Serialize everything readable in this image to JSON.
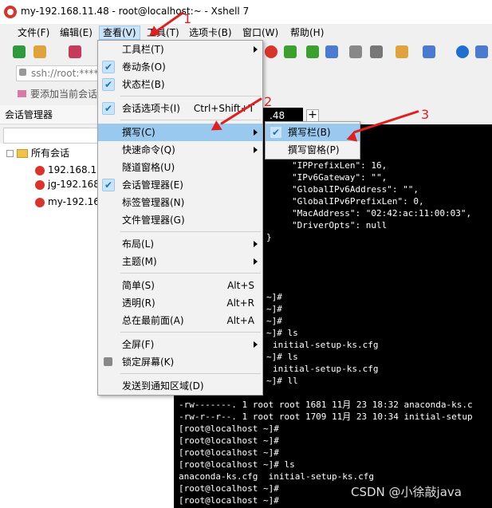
{
  "window": {
    "title": "my-192.168.11.48 - root@localhost:~ - Xshell 7"
  },
  "menubar": {
    "items": [
      "文件(F)",
      "编辑(E)",
      "查看(V)",
      "工具(T)",
      "选项卡(B)",
      "窗口(W)",
      "帮助(H)"
    ]
  },
  "addressbar": {
    "value": "ssh://root:*****"
  },
  "linkbar": {
    "text": "要添加当前会话"
  },
  "session_panel": {
    "title": "会话管理器",
    "tree": [
      {
        "label": "所有会话"
      },
      {
        "label": "192.168.16"
      },
      {
        "label": "jg-192.168"
      },
      {
        "label": "my-192.16"
      }
    ]
  },
  "tab": {
    "active_label": ".48",
    "add_label": "+"
  },
  "view_menu": {
    "items": [
      {
        "label": "工具栏(T)",
        "accel": "",
        "check": false,
        "sub": true
      },
      {
        "label": "卷动条(O)",
        "accel": "",
        "check": true,
        "sub": false
      },
      {
        "label": "状态栏(B)",
        "accel": "",
        "check": true,
        "sub": false
      },
      {
        "label": "会话选项卡(I)",
        "accel": "Ctrl+Shift+T",
        "check": true,
        "sub": false
      },
      {
        "label": "撰写(C)",
        "accel": "",
        "check": false,
        "sub": true
      },
      {
        "label": "快速命令(Q)",
        "accel": "",
        "check": false,
        "sub": true
      },
      {
        "label": "隧道窗格(U)",
        "accel": "",
        "check": false,
        "sub": false
      },
      {
        "label": "会话管理器(E)",
        "accel": "",
        "check": true,
        "sub": false
      },
      {
        "label": "标签管理器(N)",
        "accel": "",
        "check": false,
        "sub": false
      },
      {
        "label": "文件管理器(G)",
        "accel": "",
        "check": false,
        "sub": false
      },
      {
        "label": "布局(L)",
        "accel": "",
        "check": false,
        "sub": true
      },
      {
        "label": "主题(M)",
        "accel": "",
        "check": false,
        "sub": true
      },
      {
        "label": "简单(S)",
        "accel": "Alt+S",
        "check": false,
        "sub": false
      },
      {
        "label": "透明(R)",
        "accel": "Alt+R",
        "check": false,
        "sub": false
      },
      {
        "label": "总在最前面(A)",
        "accel": "Alt+A",
        "check": false,
        "sub": false
      },
      {
        "label": "全屏(F)",
        "accel": "",
        "check": false,
        "sub": true
      },
      {
        "label": "锁定屏幕(K)",
        "accel": "",
        "check": false,
        "sub": false
      },
      {
        "label": "发送到通知区域(D)",
        "accel": "",
        "check": false,
        "sub": false
      }
    ]
  },
  "compose_submenu": {
    "items": [
      {
        "label": "撰写栏(B)",
        "check": true
      },
      {
        "label": "撰写窗格(P)",
        "check": false
      }
    ]
  },
  "annotations": [
    "1",
    "2",
    "3"
  ],
  "terminal": {
    "lines": [
      "\"IPPrefixLen\": 16,",
      "\"IPv6Gateway\": \"\",",
      "\"GlobalIPv6Address\": \"\",",
      "\"GlobalIPv6PrefixLen\": 0,",
      "\"MacAddress\": \"02:42:ac:11:00:03\",",
      "\"DriverOpts\": null",
      "}",
      "~]#",
      "~]#",
      "~]#",
      "~]# ls",
      "initial-setup-ks.cfg",
      "~]# ls",
      "initial-setup-ks.cfg",
      "~]# ll",
      "-rw-------. 1 root root 1681 11月 23 18:32 anaconda-ks.c",
      "-rw-r--r--. 1 root root 1709 11月 23 10:34 initial-setup",
      "[root@localhost ~]#",
      "[root@localhost ~]#",
      "[root@localhost ~]#",
      "[root@localhost ~]# ls",
      "anaconda-ks.cfg  initial-setup-ks.cfg",
      "[root@localhost ~]#",
      "[root@localhost ~]#"
    ]
  },
  "watermark": "CSDN @小徐敲java"
}
